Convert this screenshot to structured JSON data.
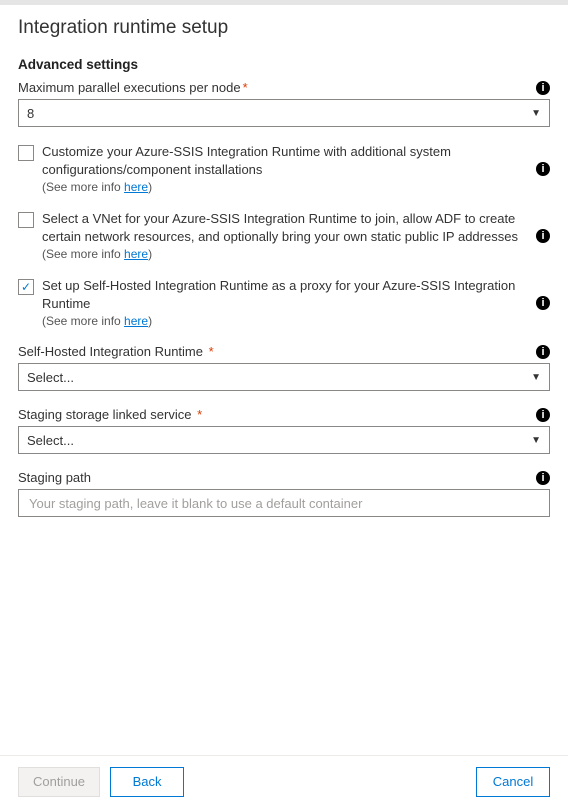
{
  "title": "Integration runtime setup",
  "section": "Advanced settings",
  "maxParallel": {
    "label": "Maximum parallel executions per node",
    "required": "*",
    "value": "8"
  },
  "checks": [
    {
      "desc": "Customize your Azure-SSIS Integration Runtime with additional system configurations/component installations",
      "moreInfoPrefix": "(See more info ",
      "moreInfoLink": "here",
      "moreInfoSuffix": ")",
      "checked": false
    },
    {
      "desc": "Select a VNet for your Azure-SSIS Integration Runtime to join, allow ADF to create certain network resources, and optionally bring your own static public IP addresses",
      "moreInfoPrefix": "(See more info ",
      "moreInfoLink": "here",
      "moreInfoSuffix": ")",
      "checked": false
    },
    {
      "desc": "Set up Self-Hosted Integration Runtime as a proxy for your Azure-SSIS Integration Runtime",
      "moreInfoPrefix": "(See more info ",
      "moreInfoLink": "here",
      "moreInfoSuffix": ")",
      "checked": true
    }
  ],
  "shir": {
    "label": "Self-Hosted Integration Runtime",
    "required": "*",
    "value": "Select..."
  },
  "staging": {
    "label": "Staging storage linked service",
    "required": "*",
    "value": "Select..."
  },
  "stagingPath": {
    "label": "Staging path",
    "placeholder": "Your staging path, leave it blank to use a default container"
  },
  "footer": {
    "continue": "Continue",
    "back": "Back",
    "cancel": "Cancel"
  }
}
